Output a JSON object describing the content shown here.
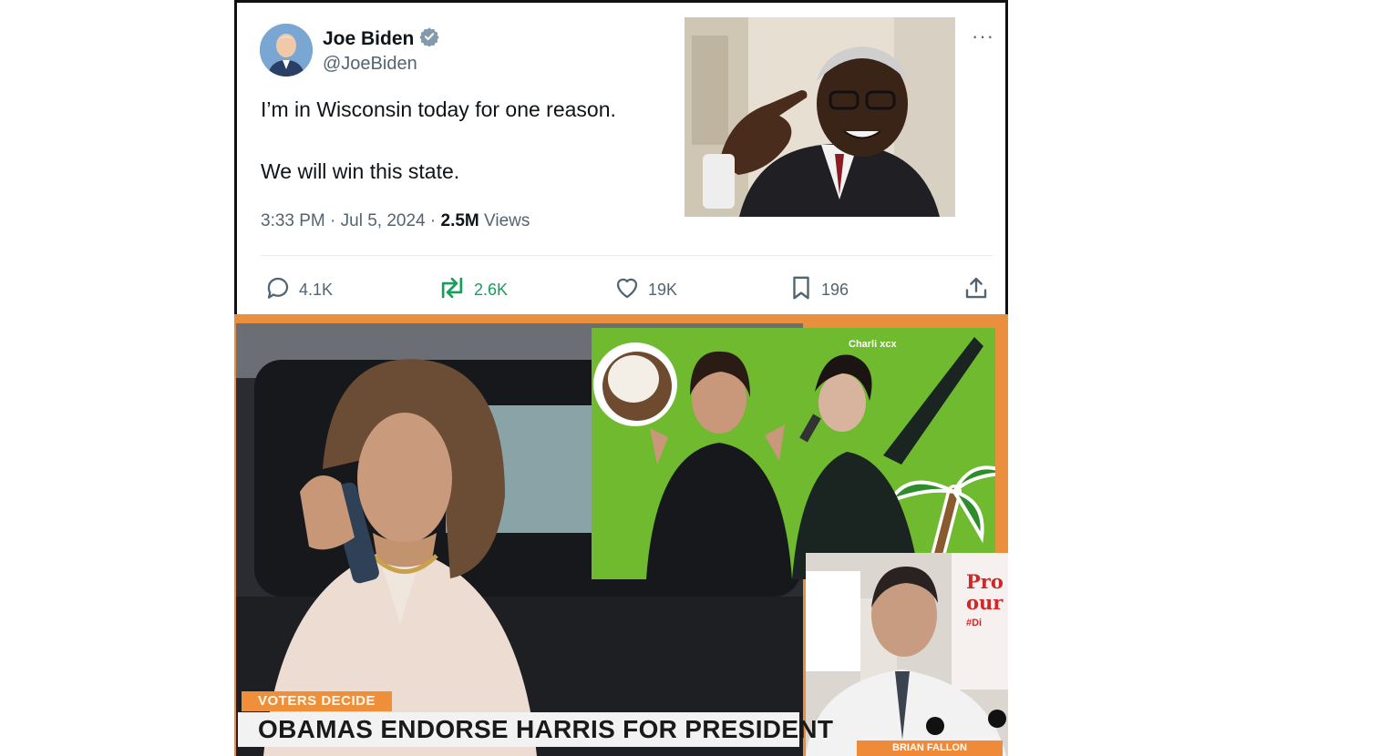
{
  "tweet": {
    "author_name": "Joe Biden",
    "author_handle": "@JoeBiden",
    "text_line_1": "I’m in Wisconsin today for one reason.",
    "text_line_2": "We will win this state.",
    "time": "3:33 PM",
    "date": "Jul 5, 2024",
    "views_count": "2.5M",
    "views_label": "Views",
    "more_label": "···",
    "actions": {
      "replies": "4.1K",
      "reposts": "2.6K",
      "likes": "19K",
      "bookmarks": "196"
    },
    "colors": {
      "text": "#0f1419",
      "secondary": "#536471",
      "repost_green": "#1a9c5e",
      "verified_badge": "#829aab"
    }
  },
  "collage": {
    "tag": "VOTERS DECIDE",
    "headline": "OBAMAS ENDORSE HARRIS FOR PRESIDENT",
    "green_panel_label": "Charli xcx",
    "sign_text": "Pro our",
    "sign_hashtag": "#Di",
    "lower_third": "BRIAN FALLON",
    "colors": {
      "frame_orange": "#ea8f3e",
      "green": "#6fba2f"
    }
  }
}
